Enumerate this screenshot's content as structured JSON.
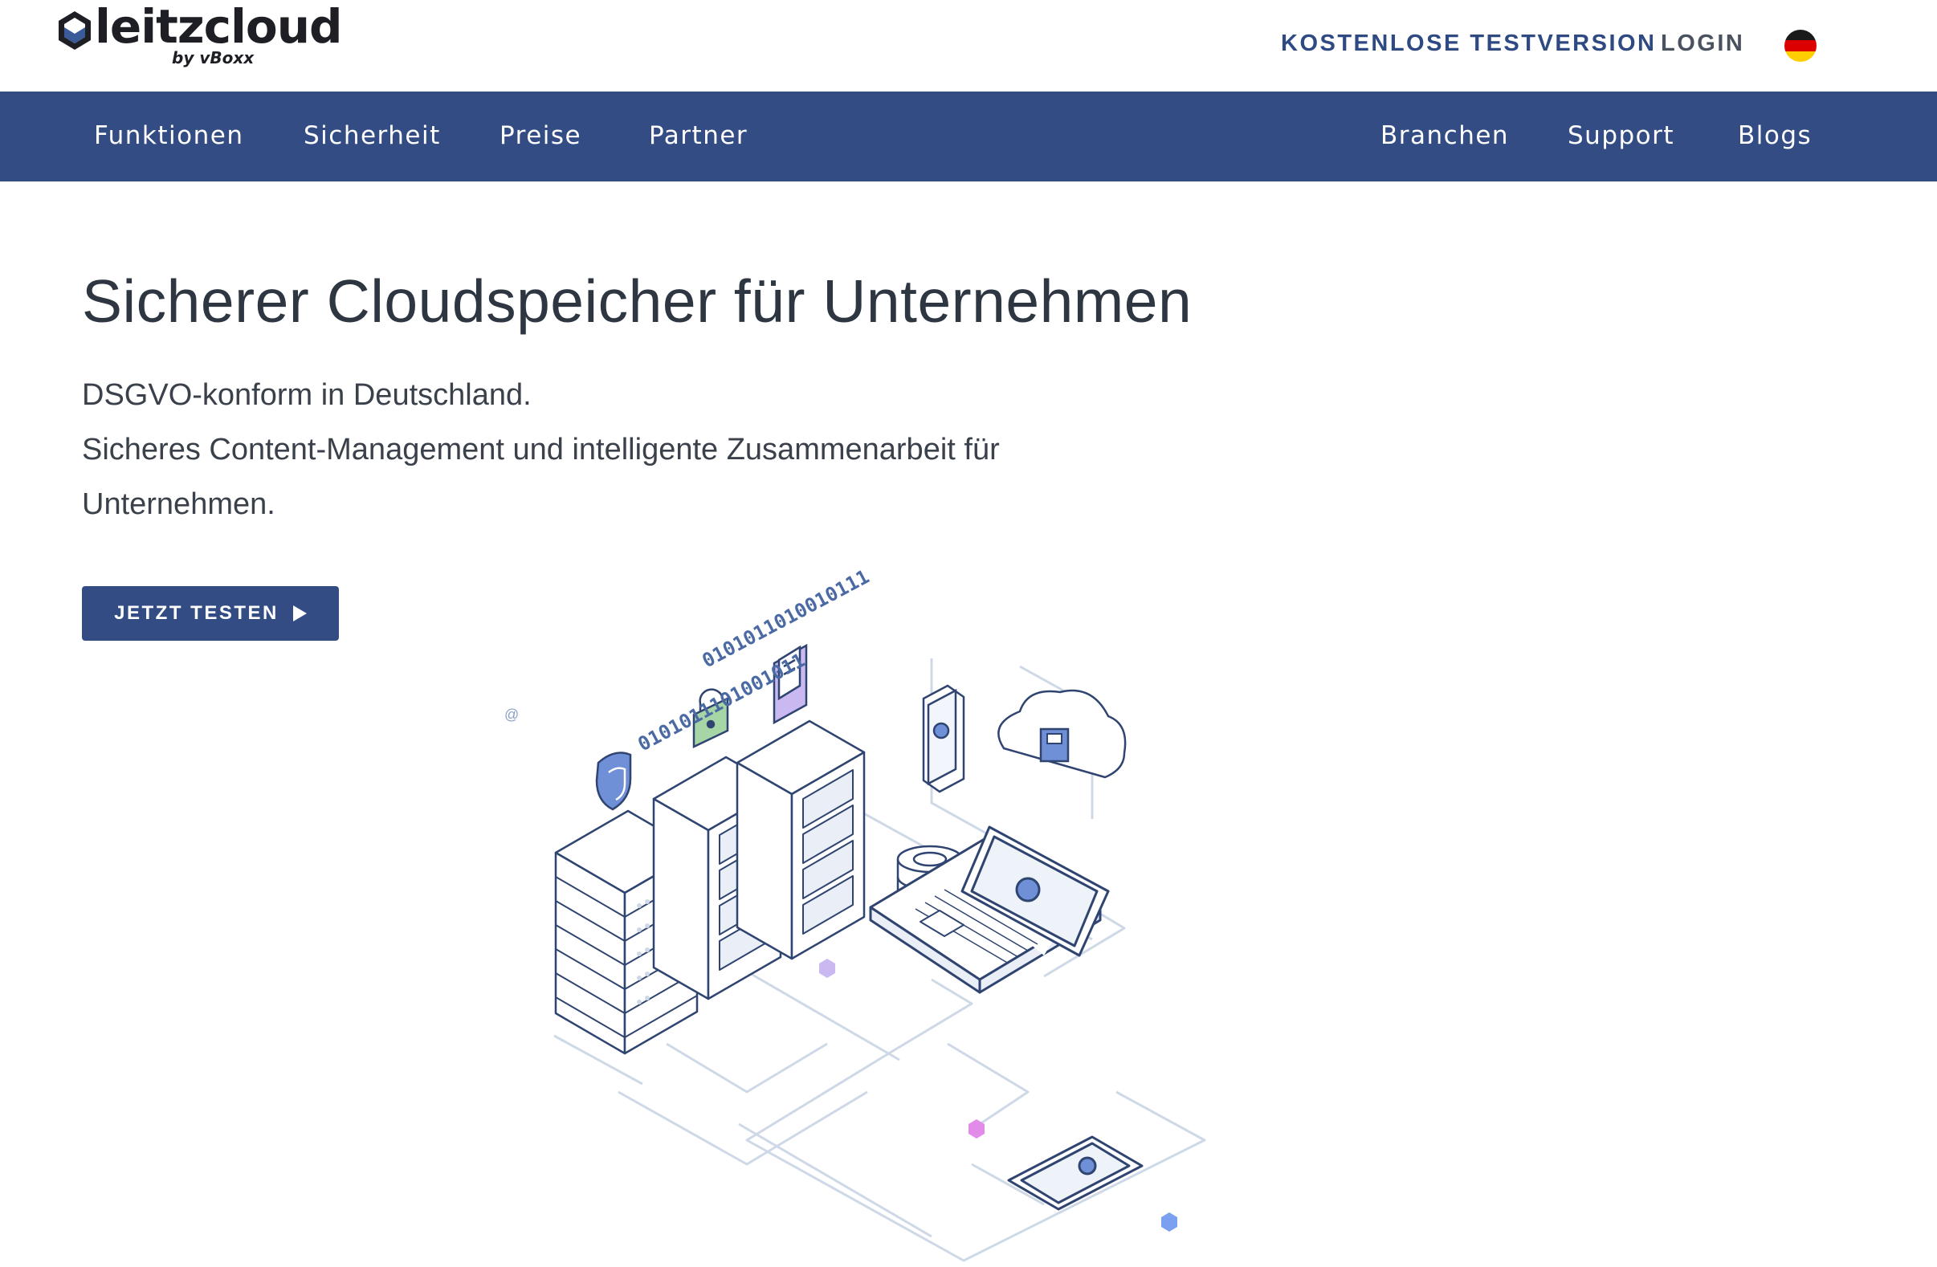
{
  "brand": {
    "name": "leitzcloud",
    "byline": "by vBoxx"
  },
  "header": {
    "trial_link": "KOSTENLOSE TESTVERSION",
    "login_link": "LOGIN",
    "language_flag": "flag-germany-icon",
    "flag_colors": [
      "#1a1a1a",
      "#dd0000",
      "#ffce00"
    ]
  },
  "nav": {
    "left": [
      {
        "label": "Funktionen"
      },
      {
        "label": "Sicherheit"
      },
      {
        "label": "Preise"
      },
      {
        "label": "Partner"
      }
    ],
    "right": [
      {
        "label": "Branchen"
      },
      {
        "label": "Support"
      },
      {
        "label": "Blogs"
      }
    ]
  },
  "hero": {
    "title": "Sicherer Cloudspeicher für Unternehmen",
    "line1": "DSGVO-konform in Deutschland.",
    "line2": "Sicheres Content-Management und intelligente Zusammenarbeit für",
    "line3": "Unternehmen.",
    "cta_label": "JETZT TESTEN"
  },
  "illustration": {
    "binary_1": "0101011010010111",
    "binary_2": "0101011101001011",
    "small_mark": "@"
  },
  "colors": {
    "brand_blue": "#334d84",
    "text_dark": "#2e3642",
    "illustration_stroke": "#2f4470",
    "accent_green": "#a7d6a6",
    "accent_purple": "#c9b9f0",
    "accent_pink": "#e38be8",
    "accent_blue": "#7aa0ef"
  }
}
